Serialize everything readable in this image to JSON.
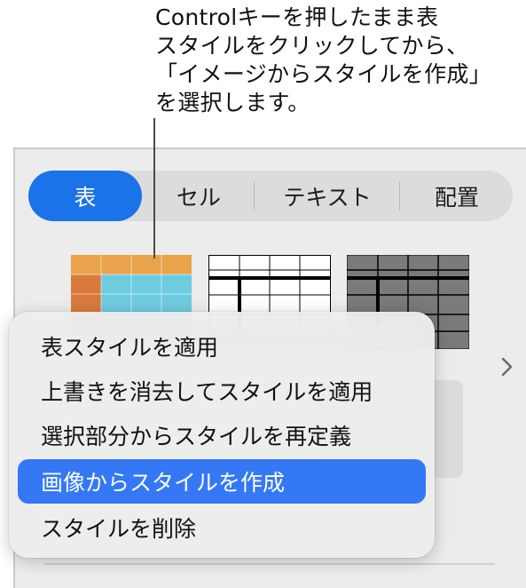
{
  "callout": {
    "lines": [
      "Controlキーを押したまま表",
      "スタイルをクリックしてから、",
      "「イメージからスタイルを作成」",
      "を選択します。"
    ]
  },
  "tabs": [
    {
      "label": "表",
      "active": true
    },
    {
      "label": "セル",
      "active": false
    },
    {
      "label": "テキスト",
      "active": false
    },
    {
      "label": "配置",
      "active": false
    }
  ],
  "colors": {
    "accent": "#1a73e8",
    "menu_highlight": "#3478f6",
    "orange": "#e8a34c",
    "orange_dark": "#d97a3c",
    "teal": "#6fcbe0",
    "gray_fill": "#7a7a7a"
  },
  "style_thumbnails": [
    {
      "name": "orange-teal-style"
    },
    {
      "name": "black-white-style"
    },
    {
      "name": "gray-style"
    }
  ],
  "context_menu": {
    "items": [
      {
        "label": "表スタイルを適用",
        "highlighted": false
      },
      {
        "label": "上書きを消去してスタイルを適用",
        "highlighted": false
      },
      {
        "label": "選択部分からスタイルを再定義",
        "highlighted": false
      },
      {
        "label": "画像からスタイルを作成",
        "highlighted": true
      },
      {
        "label": "スタイルを削除",
        "highlighted": false
      }
    ]
  },
  "icons": {
    "next": "chevron-right-icon"
  }
}
